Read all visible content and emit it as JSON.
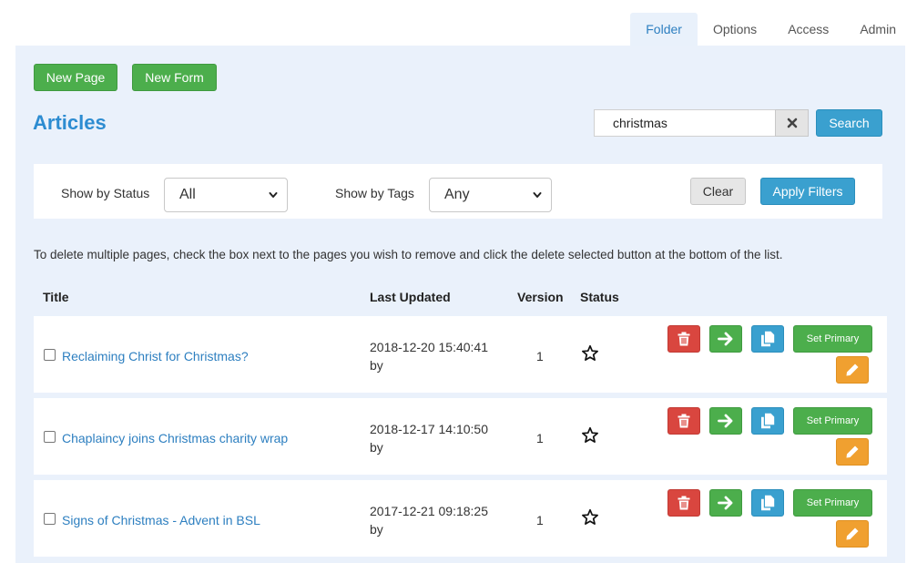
{
  "tabs": [
    {
      "label": "Folder"
    },
    {
      "label": "Options"
    },
    {
      "label": "Access"
    },
    {
      "label": "Admin"
    }
  ],
  "toolbar": {
    "new_page": "New Page",
    "new_form": "New Form"
  },
  "page_title": "Articles",
  "search": {
    "value": "christmas",
    "button": "Search"
  },
  "filters": {
    "status_label": "Show by Status",
    "status_value": "All",
    "tags_label": "Show by Tags",
    "tags_value": "Any",
    "clear": "Clear",
    "apply": "Apply Filters"
  },
  "hint": "To delete multiple pages, check the box next to the pages you wish to remove and click the delete selected button at the bottom of the list.",
  "table": {
    "headers": {
      "title": "Title",
      "updated": "Last Updated",
      "version": "Version",
      "status": "Status"
    },
    "rows": [
      {
        "title": "Reclaiming Christ for Christmas?",
        "date": "2018-12-20 15:40:41",
        "by": "by",
        "version": "1",
        "set_primary": "Set Primary"
      },
      {
        "title": "Chaplaincy joins Christmas charity wrap",
        "date": "2018-12-17 14:10:50",
        "by": "by",
        "version": "1",
        "set_primary": "Set Primary"
      },
      {
        "title": "Signs of Christmas - Advent in BSL",
        "date": "2017-12-21 09:18:25",
        "by": "by",
        "version": "1",
        "set_primary": "Set Primary"
      }
    ]
  },
  "colors": {
    "accent": "#2d8cd1",
    "panel_bg": "#eaf1fb",
    "green": "#4cae4c",
    "blue": "#3aa0cf",
    "red": "#d9463f",
    "orange": "#f0a030"
  },
  "icons": {
    "delete": "trash-icon",
    "open": "arrow-right-icon",
    "copy": "copy-icon",
    "edit": "pencil-icon",
    "status": "star-icon",
    "clear_search": "close-icon",
    "select": "chevron-down-icon"
  }
}
